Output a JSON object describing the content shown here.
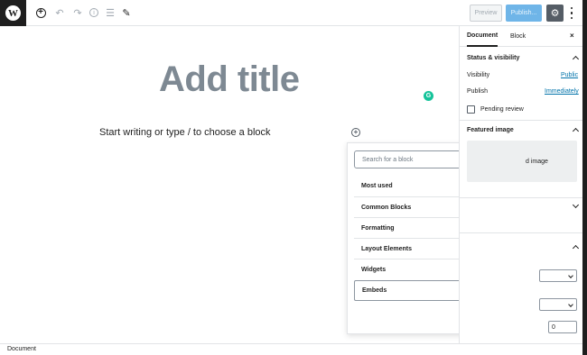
{
  "toolbar": {
    "logo_letter": "W",
    "preview_label": "Preview",
    "publish_label": "Publish..."
  },
  "editor": {
    "title_placeholder": "Add title",
    "block_placeholder": "Start writing or type / to choose a block"
  },
  "inserter": {
    "search_placeholder": "Search for a block",
    "sections": [
      "Most used",
      "Common Blocks",
      "Formatting",
      "Layout Elements",
      "Widgets",
      "Embeds"
    ]
  },
  "sidebar": {
    "tabs": [
      "Document",
      "Block"
    ],
    "close_label": "×",
    "status_heading": "Status & visibility",
    "visibility_label": "Visibility",
    "visibility_value": "Public",
    "publish_label": "Publish",
    "publish_value": "Immediately",
    "pending_label": "Pending review",
    "featured_heading": "Featured image",
    "featured_button": "d image",
    "number_value": "0"
  },
  "footer": {
    "breadcrumb": "Document"
  },
  "colors": {
    "accent": "#0073aa",
    "publish_button": "#6fb5e8",
    "title_gray": "#7e8993",
    "grammarly": "#15c39a"
  }
}
